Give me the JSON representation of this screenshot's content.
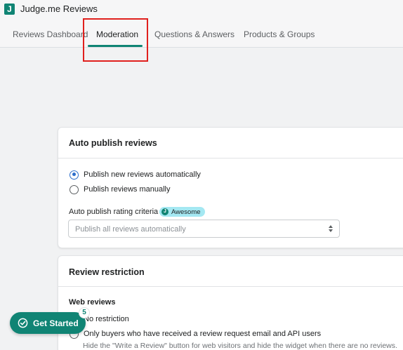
{
  "app": {
    "logo_letter": "J",
    "title": "Judge.me Reviews"
  },
  "tabs": [
    {
      "label": "Reviews Dashboard",
      "active": false
    },
    {
      "label": "Moderation",
      "active": true
    },
    {
      "label": "Questions & Answers",
      "active": false
    },
    {
      "label": "Products & Groups",
      "active": false
    }
  ],
  "auto_publish": {
    "title": "Auto publish reviews",
    "options": [
      {
        "label": "Publish new reviews automatically",
        "checked": true
      },
      {
        "label": "Publish reviews manually",
        "checked": false
      }
    ],
    "criteria_label": "Auto publish rating criteria",
    "badge_letter": "J",
    "badge": "Awesome",
    "select_value": "Publish all reviews automatically"
  },
  "review_restriction": {
    "title": "Review restriction",
    "section": "Web reviews",
    "options": [
      {
        "label": "No restriction",
        "checked": false
      },
      {
        "label": "Only buyers who have received a review request email and API users",
        "checked": false
      }
    ],
    "help": "Hide the \"Write a Review\" button for web visitors and hide the widget when there are no reviews."
  },
  "get_started": {
    "label": "Get Started",
    "count": "5"
  },
  "colors": {
    "accent": "#108474",
    "radio_checked": "#2c6ecb",
    "highlight": "#e0201d",
    "badge_bg": "#a4e8f2"
  },
  "icons": [
    "app-logo",
    "check-circle-icon",
    "select-arrows-icon",
    "judgeme-badge-icon"
  ]
}
